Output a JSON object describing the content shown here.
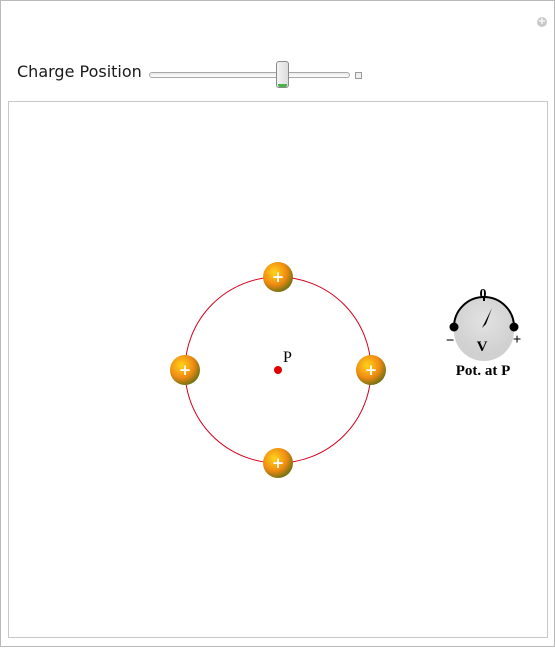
{
  "control": {
    "label": "Charge Position",
    "slider_value_fraction": 0.67,
    "expand_symbol": "+"
  },
  "corner_button": {
    "symbol": "+"
  },
  "scene": {
    "point_label": "P",
    "charges": [
      {
        "sign": "+"
      },
      {
        "sign": "+"
      },
      {
        "sign": "+"
      },
      {
        "sign": "+"
      }
    ],
    "ring_color": "#d6001c",
    "point_color": "#e00000"
  },
  "meter": {
    "zero_label": "0",
    "minus_label": "−",
    "plus_label": "+",
    "unit_label": "V",
    "caption": "Pot. at P"
  }
}
